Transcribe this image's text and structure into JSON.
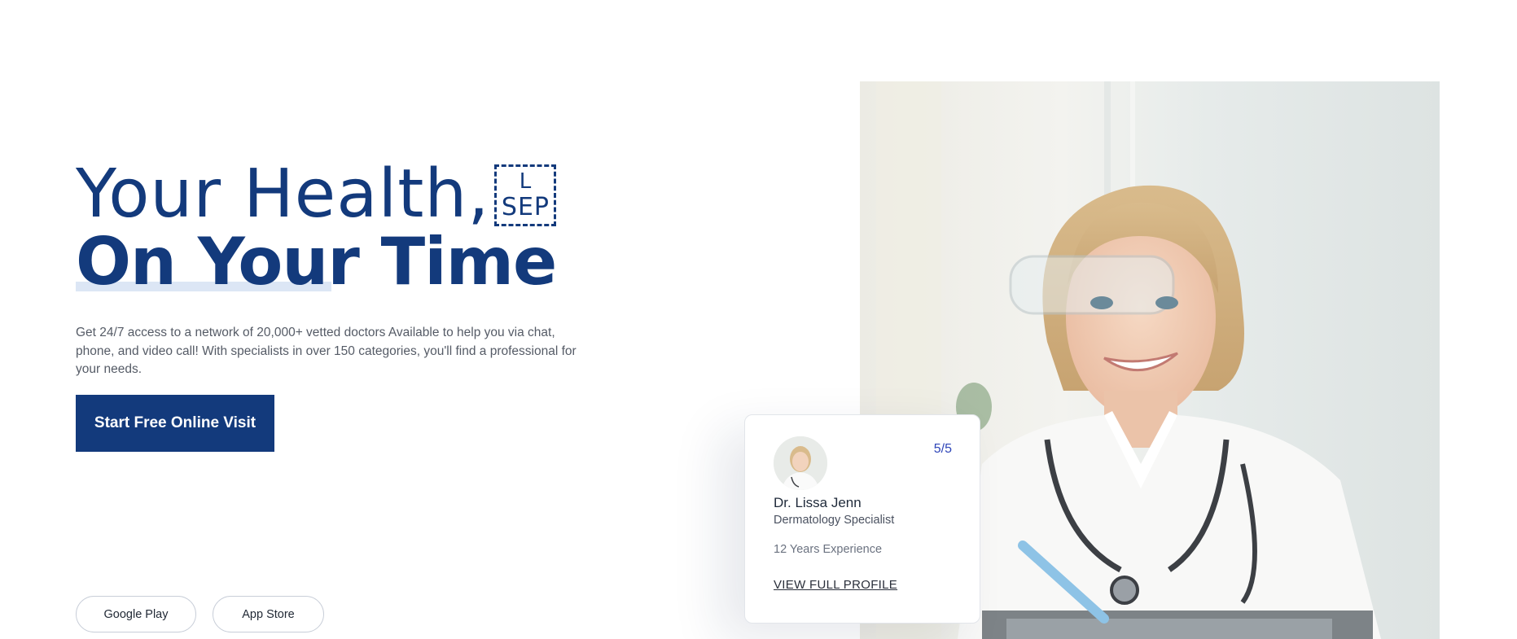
{
  "hero": {
    "title_line_1": "Your Health,",
    "title_sep_top": "L",
    "title_sep_bottom": "SEP",
    "title_line_2": "On Your Time",
    "description": "Get 24/7 access to a network of 20,000+ vetted doctors Available to help you via chat, phone, and video call! With specialists in over 150 categories, you'll find a professional for your needs.",
    "cta_label": "Start Free Online Visit"
  },
  "stores": {
    "google_play": "Google Play",
    "app_store": "App Store"
  },
  "doctor_card": {
    "rating": "5/5",
    "name": "Dr. Lissa Jenn",
    "specialty": "Dermatology Specialist",
    "experience": "12 Years Experience",
    "profile_link": "VIEW FULL PROFILE"
  },
  "colors": {
    "brand_navy": "#133a7c",
    "rating_blue": "#2e45b8",
    "text_gray": "#555b66"
  }
}
